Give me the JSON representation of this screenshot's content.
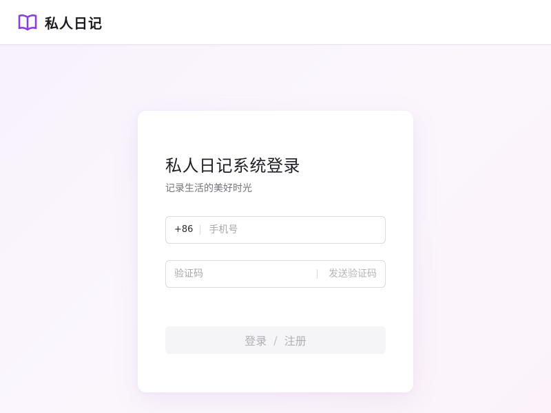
{
  "header": {
    "logo_icon": "book-open-icon",
    "brand_color": "#8b3fe0",
    "app_name": "私人日记"
  },
  "login": {
    "title": "私人日记系统登录",
    "subtitle": "记录生活的美好时光",
    "phone": {
      "country_code": "+86",
      "placeholder": "手机号",
      "value": ""
    },
    "code": {
      "placeholder": "验证码",
      "value": "",
      "send_label": "发送验证码"
    },
    "submit": {
      "login_label": "登录",
      "separator": "/",
      "register_label": "注册"
    }
  }
}
